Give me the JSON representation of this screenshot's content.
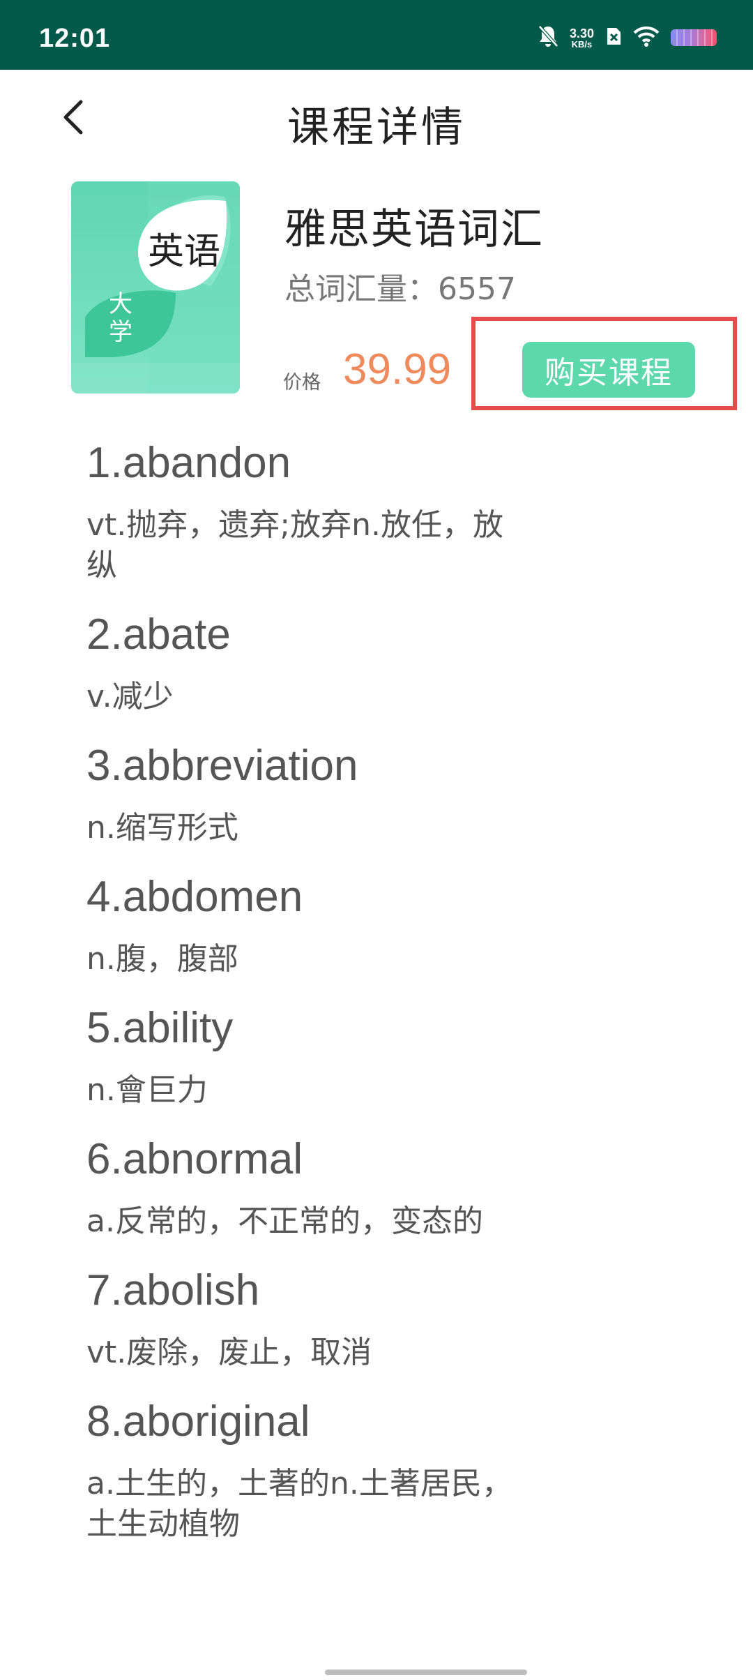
{
  "status_bar": {
    "time": "12:01",
    "net_speed_value": "3.30",
    "net_speed_unit": "KB/s",
    "battery_colors": [
      "#8a8cf0",
      "#f0506f"
    ],
    "icons": [
      "mute-bell-icon",
      "sim-x-icon",
      "wifi-icon",
      "battery-icon"
    ]
  },
  "header": {
    "title": "课程详情",
    "back_icon": "chevron-left-icon"
  },
  "course": {
    "cover_main_text": "英语",
    "cover_badge_text": "大学",
    "name": "雅思英语词汇",
    "word_count": "总词汇量：6557",
    "price_label": "价格",
    "price": "39.99",
    "buy_label": "购买课程",
    "buy_color": "#5dd8ad",
    "price_color": "#ef8a5c",
    "highlight_color": "#e54d4d"
  },
  "words": [
    {
      "term": "1.abandon",
      "definition": "vt.抛弃，遗弃;放弃n.放任，放纵"
    },
    {
      "term": "2.abate",
      "definition": "v.减少"
    },
    {
      "term": "3.abbreviation",
      "definition": "n.缩写形式"
    },
    {
      "term": "4.abdomen",
      "definition": "n.腹，腹部"
    },
    {
      "term": "5.ability",
      "definition": "n.會巨力"
    },
    {
      "term": "6.abnormal",
      "definition": "a.反常的，不正常的，变态的"
    },
    {
      "term": "7.abolish",
      "definition": "vt.废除，废止，取消"
    },
    {
      "term": "8.aboriginal",
      "definition": "a.土生的，土著的n.土著居民，土生动植物"
    }
  ]
}
